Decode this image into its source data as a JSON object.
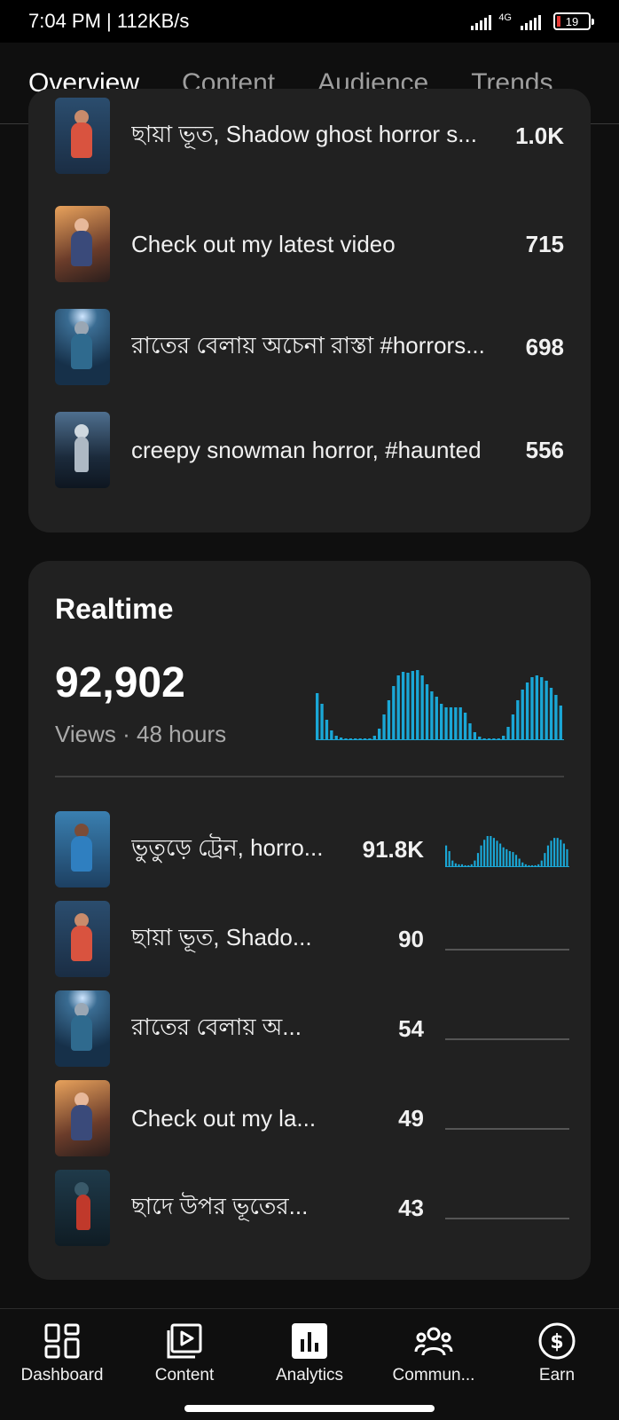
{
  "status_bar": {
    "time": "7:04 PM | 112KB/s",
    "network": "4G",
    "battery": "19"
  },
  "tabs": [
    {
      "label": "Overview",
      "active": true
    },
    {
      "label": "Content",
      "active": false
    },
    {
      "label": "Audience",
      "active": false
    },
    {
      "label": "Trends",
      "active": false
    }
  ],
  "top_content": [
    {
      "title": "ছায়া ভূত, Shadow ghost horror s...",
      "value": "1.0K"
    },
    {
      "title": "Check out my latest video",
      "value": "715"
    },
    {
      "title": "রাতের বেলায় অচেনা রাস্তা #horrors...",
      "value": "698"
    },
    {
      "title": "creepy snowman horror, #haunted",
      "value": "556"
    }
  ],
  "realtime": {
    "title": "Realtime",
    "views": "92,902",
    "subtitle": "Views · 48 hours",
    "accent": "#1aa7d6",
    "hourly_bars": [
      52,
      40,
      22,
      10,
      4,
      2,
      1,
      1,
      1,
      1,
      1,
      1,
      4,
      12,
      28,
      44,
      60,
      72,
      76,
      75,
      77,
      78,
      72,
      62,
      54,
      48,
      40,
      36,
      36,
      36,
      36,
      30,
      18,
      8,
      3,
      1,
      1,
      1,
      1,
      4,
      14,
      28,
      44,
      56,
      64,
      70,
      72,
      70,
      66,
      58,
      50,
      38
    ],
    "items": [
      {
        "title": "ভুতুড়ে ট্রেন, horro...",
        "value": "91.8K",
        "has_activity": true
      },
      {
        "title": "ছায়া ভূত, Shado...",
        "value": "90",
        "has_activity": false
      },
      {
        "title": "রাতের বেলায় অ...",
        "value": "54",
        "has_activity": false
      },
      {
        "title": "Check out my la...",
        "value": "49",
        "has_activity": false
      },
      {
        "title": "ছাদে উপর ভূতের...",
        "value": "43",
        "has_activity": false
      }
    ],
    "item_spark": [
      22,
      16,
      6,
      3,
      2,
      2,
      1,
      1,
      2,
      6,
      14,
      22,
      28,
      32,
      32,
      30,
      27,
      24,
      20,
      18,
      16,
      15,
      12,
      8,
      4,
      2,
      1,
      1,
      1,
      2,
      6,
      14,
      22,
      27,
      30,
      30,
      28,
      24,
      18
    ]
  },
  "bottom_nav": [
    {
      "label": "Dashboard",
      "icon": "dashboard-icon"
    },
    {
      "label": "Content",
      "icon": "content-icon"
    },
    {
      "label": "Analytics",
      "icon": "analytics-icon"
    },
    {
      "label": "Commun...",
      "icon": "community-icon"
    },
    {
      "label": "Earn",
      "icon": "earn-icon"
    }
  ]
}
